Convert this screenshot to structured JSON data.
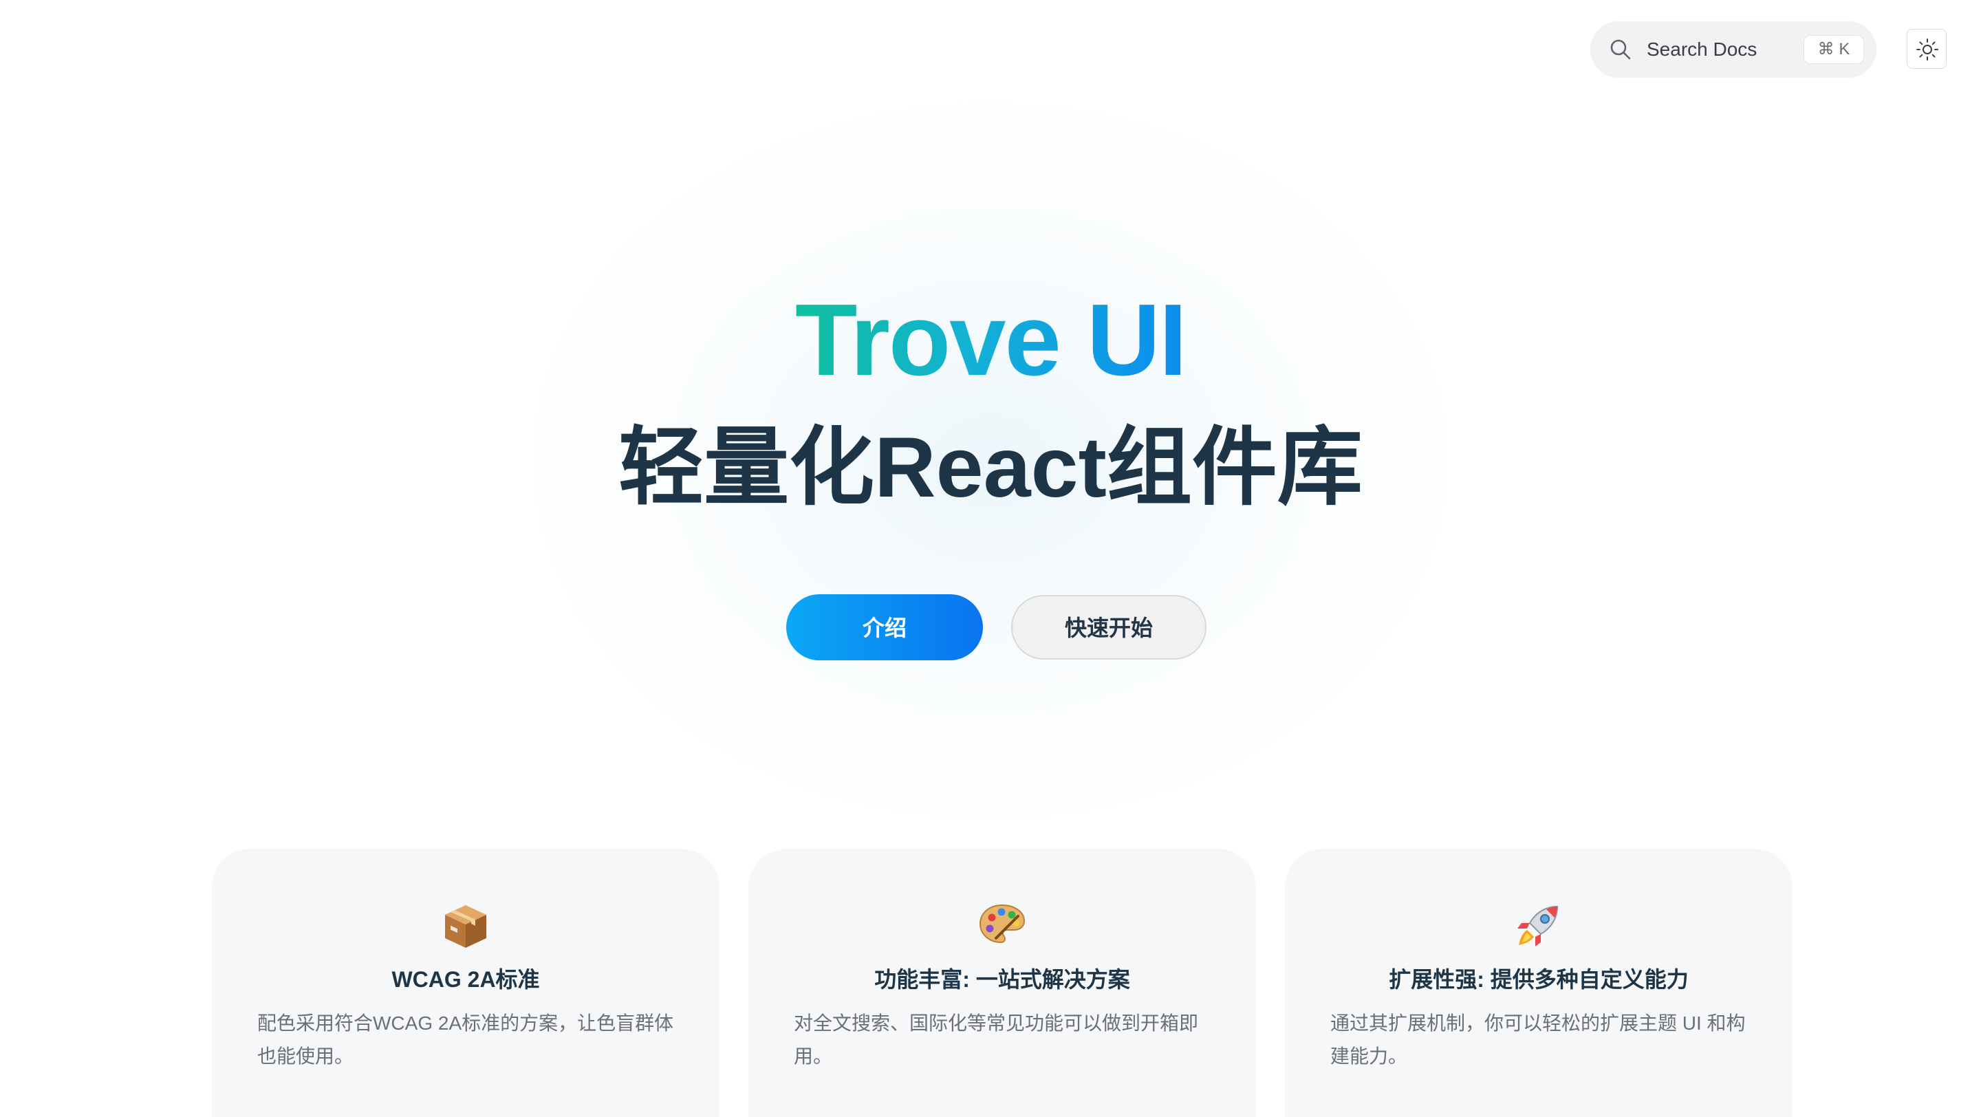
{
  "header": {
    "search_placeholder": "Search Docs",
    "search_shortcut": "⌘ K",
    "theme_toggle_icon": "sun-icon"
  },
  "hero": {
    "title": "Trove UI",
    "subtitle": "轻量化React组件库",
    "primary_button": "介绍",
    "secondary_button": "快速开始"
  },
  "features": [
    {
      "icon": "package-icon",
      "title": "WCAG 2A标准",
      "description": "配色采用符合WCAG 2A标准的方案，让色盲群体也能使用。"
    },
    {
      "icon": "palette-icon",
      "title": "功能丰富: 一站式解决方案",
      "description": "对全文搜索、国际化等常见功能可以做到开箱即用。"
    },
    {
      "icon": "rocket-icon",
      "title": "扩展性强: 提供多种自定义能力",
      "description": "通过其扩展机制，你可以轻松的扩展主题 UI 和构建能力。"
    }
  ],
  "colors": {
    "title_gradient_start": "#0ebf9c",
    "title_gradient_end": "#0b8df0",
    "primary_button": "#0a8cf2",
    "heading_text": "#1e3548"
  }
}
